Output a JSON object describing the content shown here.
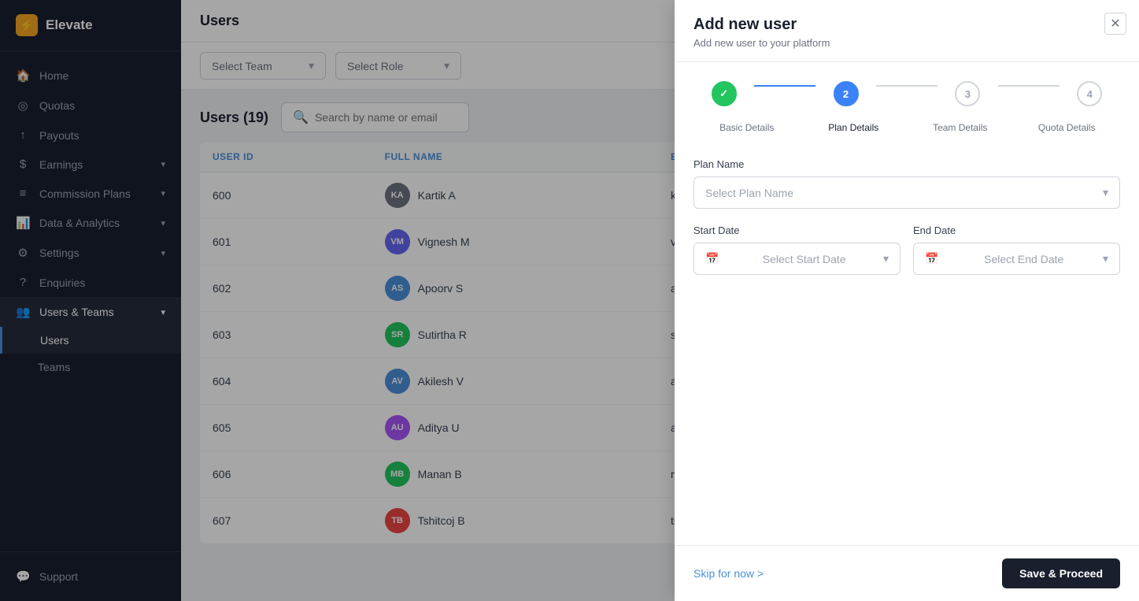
{
  "app": {
    "name": "Elevate",
    "logo_icon": "⚡"
  },
  "sidebar": {
    "nav_items": [
      {
        "id": "home",
        "label": "Home",
        "icon": "🏠",
        "has_children": false
      },
      {
        "id": "quotas",
        "label": "Quotas",
        "icon": "◎",
        "has_children": false
      },
      {
        "id": "payouts",
        "label": "Payouts",
        "icon": "📤",
        "has_children": false
      },
      {
        "id": "earnings",
        "label": "Earnings",
        "icon": "💰",
        "has_children": true
      },
      {
        "id": "commission-plans",
        "label": "Commission Plans",
        "icon": "📋",
        "has_children": true
      },
      {
        "id": "data-analytics",
        "label": "Data & Analytics",
        "icon": "📊",
        "has_children": true
      },
      {
        "id": "settings",
        "label": "Settings",
        "icon": "⚙️",
        "has_children": true
      },
      {
        "id": "enquiries",
        "label": "Enquiries",
        "icon": "❓",
        "has_children": false
      },
      {
        "id": "users-teams",
        "label": "Users & Teams",
        "icon": "👥",
        "has_children": true
      }
    ],
    "sub_items": [
      {
        "id": "users",
        "label": "Users",
        "active": true
      },
      {
        "id": "teams",
        "label": "Teams",
        "active": false
      }
    ],
    "bottom_items": [
      {
        "id": "support",
        "label": "Support",
        "icon": "💬"
      }
    ]
  },
  "page": {
    "title": "Users",
    "filters": {
      "team_placeholder": "Select Team",
      "role_placeholder": "Select Role"
    },
    "table": {
      "title": "Users (19)",
      "search_placeholder": "Search by name or email",
      "columns": [
        "USER ID",
        "FULL NAME",
        "EMAIL"
      ],
      "rows": [
        {
          "id": "600",
          "name": "Kartik A",
          "email": "kartik_elevate@yopmail.com",
          "avatar_initials": "KA",
          "avatar_color": "#6b7280"
        },
        {
          "id": "601",
          "name": "Vignesh M",
          "email": "vignesh_elevate@yopmail.com",
          "avatar_initials": "VM",
          "avatar_color": "#6366f1"
        },
        {
          "id": "602",
          "name": "Apoorv S",
          "email": "apoorv_elevate@yopmail.com",
          "avatar_initials": "AS",
          "avatar_color": "#4a90d9"
        },
        {
          "id": "603",
          "name": "Sutirtha R",
          "email": "sutirtha_elevate@yopmail.com",
          "avatar_initials": "SR",
          "avatar_color": "#22c55e"
        },
        {
          "id": "604",
          "name": "Akilesh V",
          "email": "akilesh_elevate@yopmail.com",
          "avatar_initials": "AV",
          "avatar_color": "#4a90d9"
        },
        {
          "id": "605",
          "name": "Aditya U",
          "email": "aditya_elevate@yopmail.com",
          "avatar_initials": "AU",
          "avatar_color": "#a855f7"
        },
        {
          "id": "606",
          "name": "Manan B",
          "email": "manan_elevate@yopmail.com",
          "avatar_initials": "MB",
          "avatar_color": "#22c55e"
        },
        {
          "id": "607",
          "name": "Tshitcoj B",
          "email": "tshitcoj_elevate@yopmail.com",
          "avatar_initials": "TB",
          "avatar_color": "#ef4444"
        }
      ]
    }
  },
  "panel": {
    "title": "Add new user",
    "subtitle": "Add new user to your platform",
    "steps": [
      {
        "id": 1,
        "label": "Basic Details",
        "state": "completed",
        "number": "✓"
      },
      {
        "id": 2,
        "label": "Plan Details",
        "state": "active",
        "number": "2"
      },
      {
        "id": 3,
        "label": "Team Details",
        "state": "pending",
        "number": "3"
      },
      {
        "id": 4,
        "label": "Quota Details",
        "state": "pending",
        "number": "4"
      }
    ],
    "form": {
      "plan_name_label": "Plan Name",
      "plan_name_placeholder": "Select Plan Name",
      "start_date_label": "Start Date",
      "start_date_placeholder": "Select Start Date",
      "end_date_label": "End Date",
      "end_date_placeholder": "Select End Date"
    },
    "footer": {
      "skip_label": "Skip for now >",
      "save_proceed_label": "Save & Proceed"
    }
  }
}
